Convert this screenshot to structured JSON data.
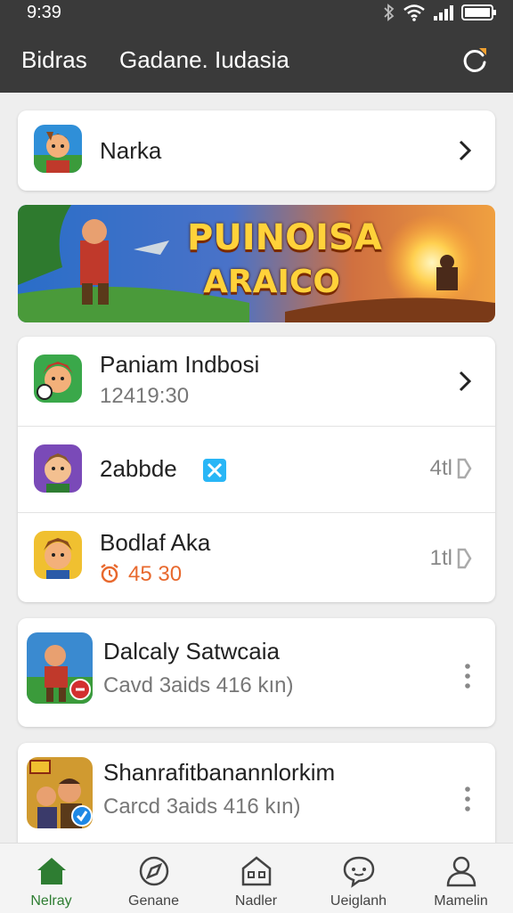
{
  "status_bar": {
    "time": "9:39"
  },
  "header": {
    "title_left": "Bidras",
    "title_main": "Gadane. Iudasia"
  },
  "top_card": {
    "title": "Narka"
  },
  "banner": {
    "line1": "PUINOISA",
    "line2": "ARAICO"
  },
  "list_group": {
    "items": [
      {
        "title": "Paniam Indbosi",
        "subtitle": "12419:30"
      },
      {
        "title": "2abbde",
        "tail": "4tl"
      },
      {
        "title": "Bodlaf Aka",
        "subtitle": "45 30",
        "tail": "1tl"
      }
    ]
  },
  "cards": [
    {
      "title": "Dalcaly Satwcaia",
      "subtitle": "Cavd 3aids 416 kın)"
    },
    {
      "title": "Shanrafitbanannlorkim",
      "subtitle": "Carcd 3aids 416 kın)"
    }
  ],
  "bottom_nav": {
    "items": [
      {
        "label": "Nelray",
        "icon": "home-icon"
      },
      {
        "label": "Genane",
        "icon": "compass-icon"
      },
      {
        "label": "Nadler",
        "icon": "store-icon"
      },
      {
        "label": "Ueiglanh",
        "icon": "chat-icon"
      },
      {
        "label": "Mamelin",
        "icon": "person-icon"
      }
    ],
    "active_index": 0
  },
  "colors": {
    "bar": "#3a3a3a",
    "accent": "#2e7d32",
    "timer": "#e8692e",
    "badge": "#29b6f6"
  }
}
